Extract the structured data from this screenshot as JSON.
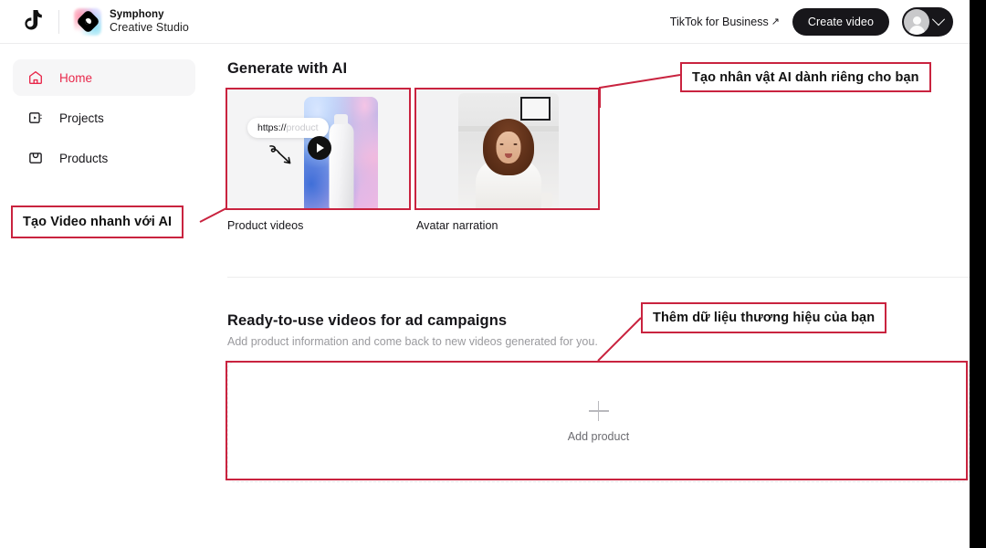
{
  "topbar": {
    "logo_icon": "tiktok-note-icon",
    "brand_icon": "symphony-diamond-icon",
    "brand_line1": "Symphony",
    "brand_line2": "Creative Studio",
    "business_link": "TikTok for Business",
    "business_link_arrow": "↗",
    "create_button": "Create video",
    "avatar_icon": "user-avatar-icon",
    "chevron_icon": "chevron-down-icon"
  },
  "sidebar": {
    "items": [
      {
        "label": "Home",
        "icon": "home-icon",
        "active": true
      },
      {
        "label": "Projects",
        "icon": "projects-video-icon",
        "active": false
      },
      {
        "label": "Products",
        "icon": "products-bag-icon",
        "active": false
      }
    ]
  },
  "generate": {
    "title": "Generate with AI",
    "cards": [
      {
        "label": "Product videos",
        "url_pill_typed": "https://",
        "url_pill_hint": "product",
        "cursor_icon": "pen-cursor-icon",
        "play_icon": "play-button-icon"
      },
      {
        "label": "Avatar narration",
        "thumb_icon": "avatar-woman-thumbnail"
      }
    ]
  },
  "ready": {
    "title": "Ready-to-use videos for ad campaigns",
    "subtitle": "Add product information and come back to new videos generated for you.",
    "add_product_label": "Add product",
    "plus_icon": "plus-icon"
  },
  "annotations": {
    "accent_color": "#c9233f",
    "items": [
      {
        "text": "Tạo nhân vật AI dành riêng cho bạn"
      },
      {
        "text": "Tạo Video nhanh với AI"
      },
      {
        "text": "Thêm dữ liệu thương hiệu của bạn"
      }
    ]
  }
}
